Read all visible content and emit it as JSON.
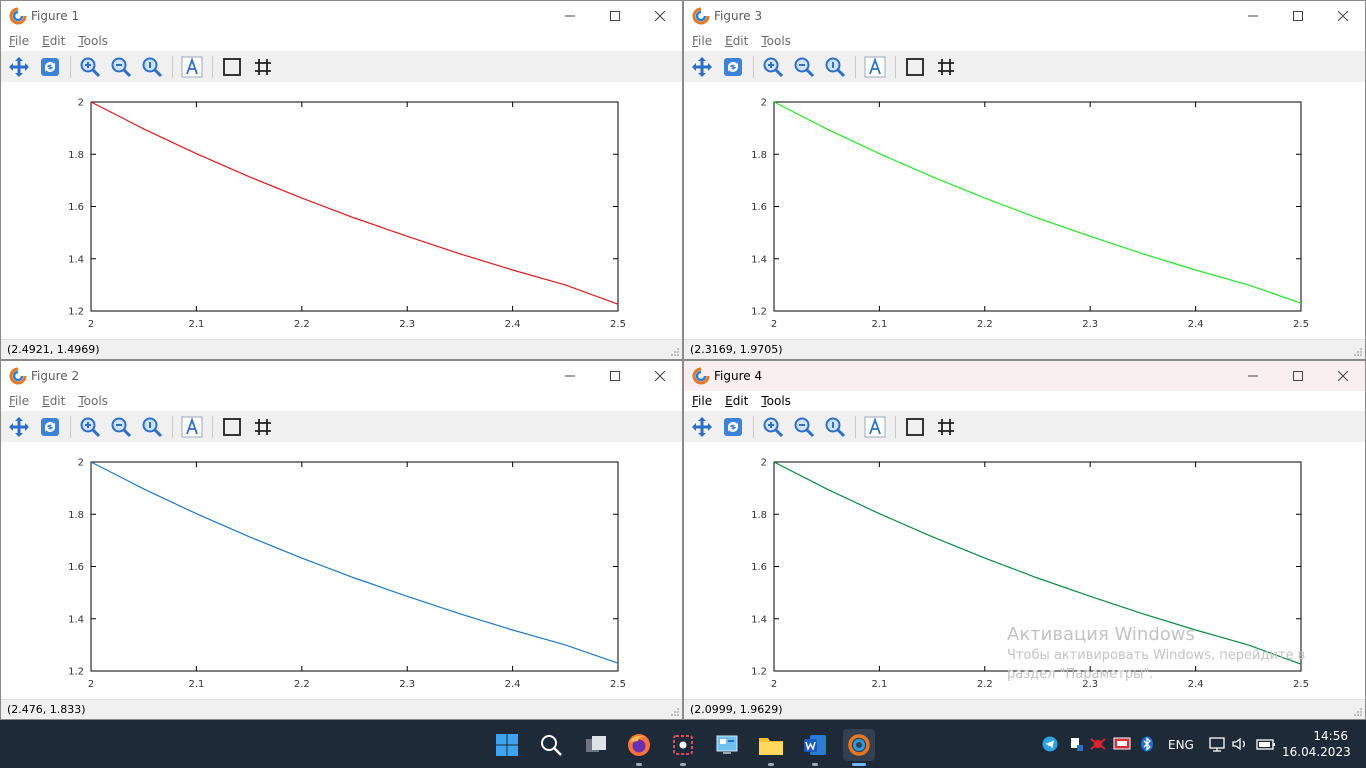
{
  "menu": {
    "file": {
      "accel": "F",
      "rest": "ile"
    },
    "edit": {
      "accel": "E",
      "rest": "dit"
    },
    "tools": {
      "accel": "T",
      "rest": "ools"
    }
  },
  "windows": [
    {
      "id": "fig1",
      "title": "Figure 1",
      "status": "(2.4921, 1.4969)",
      "line_color": "#e0191b",
      "active": false
    },
    {
      "id": "fig3",
      "title": "Figure 3",
      "status": "(2.3169, 1.9705)",
      "line_color": "#22e82a",
      "active": false
    },
    {
      "id": "fig2",
      "title": "Figure 2",
      "status": "(2.476, 1.833)",
      "line_color": "#1f78c0",
      "active": false
    },
    {
      "id": "fig4",
      "title": "Figure 4",
      "status": "(2.0999, 1.9629)",
      "line_color": "#0a8a44",
      "active": true
    }
  ],
  "chart_data": [
    {
      "type": "line",
      "figure": "Figure 1",
      "xlim": [
        2,
        2.5
      ],
      "ylim": [
        1.2,
        2
      ],
      "xticks": [
        "2",
        "2.1",
        "2.2",
        "2.3",
        "2.4",
        "2.5"
      ],
      "yticks": [
        "1.2",
        "1.4",
        "1.6",
        "1.8",
        "2"
      ],
      "x": [
        2.0,
        2.05,
        2.1,
        2.15,
        2.2,
        2.25,
        2.3,
        2.35,
        2.4,
        2.45,
        2.5
      ],
      "y": [
        2.0,
        1.897,
        1.802,
        1.714,
        1.632,
        1.556,
        1.486,
        1.419,
        1.357,
        1.3,
        1.226
      ]
    },
    {
      "type": "line",
      "figure": "Figure 3",
      "xlim": [
        2,
        2.5
      ],
      "ylim": [
        1.2,
        2
      ],
      "xticks": [
        "2",
        "2.1",
        "2.2",
        "2.3",
        "2.4",
        "2.5"
      ],
      "yticks": [
        "1.2",
        "1.4",
        "1.6",
        "1.8",
        "2"
      ],
      "x": [
        2.0,
        2.05,
        2.1,
        2.15,
        2.2,
        2.25,
        2.3,
        2.35,
        2.4,
        2.45,
        2.5
      ],
      "y": [
        2.0,
        1.897,
        1.802,
        1.714,
        1.632,
        1.556,
        1.486,
        1.419,
        1.357,
        1.3,
        1.23
      ]
    },
    {
      "type": "line",
      "figure": "Figure 2",
      "xlim": [
        2,
        2.5
      ],
      "ylim": [
        1.2,
        2
      ],
      "xticks": [
        "2",
        "2.1",
        "2.2",
        "2.3",
        "2.4",
        "2.5"
      ],
      "yticks": [
        "1.2",
        "1.4",
        "1.6",
        "1.8",
        "2"
      ],
      "x": [
        2.0,
        2.05,
        2.1,
        2.15,
        2.2,
        2.25,
        2.3,
        2.35,
        2.4,
        2.45,
        2.5
      ],
      "y": [
        2.0,
        1.897,
        1.802,
        1.714,
        1.632,
        1.556,
        1.486,
        1.419,
        1.357,
        1.3,
        1.23
      ]
    },
    {
      "type": "line",
      "figure": "Figure 4",
      "xlim": [
        2,
        2.5
      ],
      "ylim": [
        1.2,
        2
      ],
      "xticks": [
        "2",
        "2.1",
        "2.2",
        "2.3",
        "2.4",
        "2.5"
      ],
      "yticks": [
        "1.2",
        "1.4",
        "1.6",
        "1.8",
        "2"
      ],
      "x": [
        2.0,
        2.05,
        2.1,
        2.15,
        2.2,
        2.25,
        2.3,
        2.35,
        2.4,
        2.45,
        2.5
      ],
      "y": [
        2.0,
        1.897,
        1.802,
        1.714,
        1.632,
        1.556,
        1.486,
        1.419,
        1.357,
        1.3,
        1.226
      ]
    }
  ],
  "watermark": {
    "title": "Активация Windows",
    "line1": "Чтобы активировать Windows, перейдите в",
    "line2": "раздел \"Параметры\"."
  },
  "taskbar": {
    "apps": [
      "windows-start-icon",
      "search-icon",
      "task-view-icon",
      "firefox-icon",
      "snipping-tool-icon",
      "control-panel-icon",
      "file-explorer-icon",
      "word-icon",
      "octave-icon"
    ],
    "language": "ENG",
    "time": "14:56",
    "date": "16.04.2023"
  }
}
